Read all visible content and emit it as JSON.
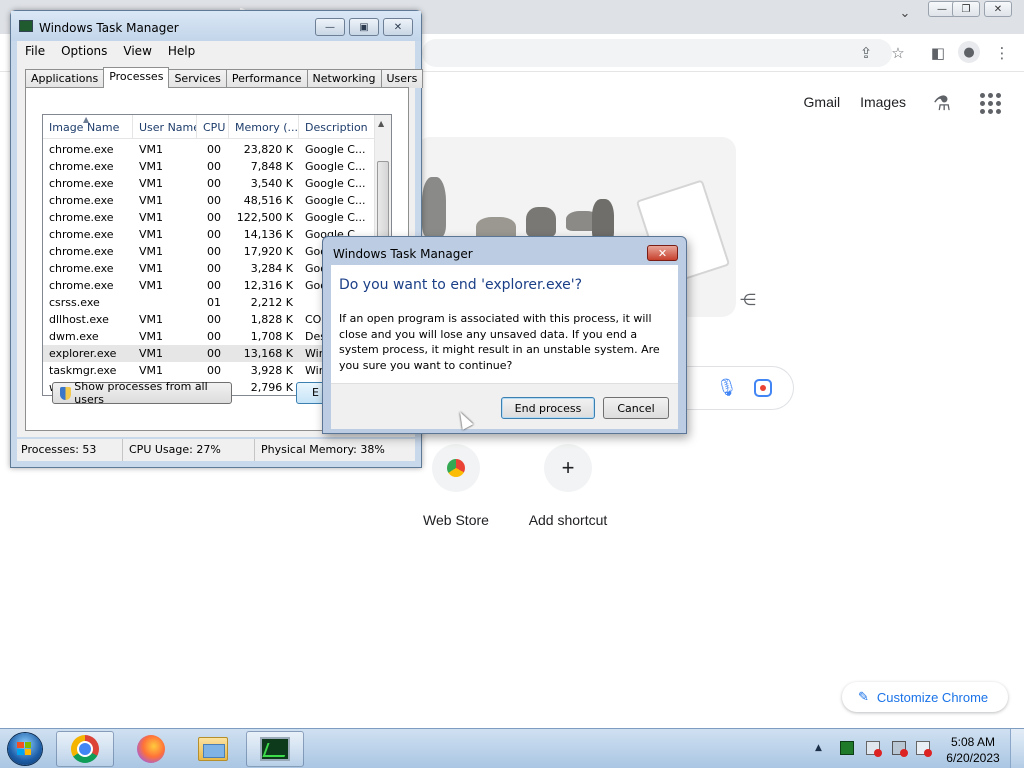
{
  "chrome": {
    "header_links": [
      "Gmail",
      "Images"
    ],
    "shortcuts": [
      {
        "label": "Web Store"
      },
      {
        "label": "Add shortcut",
        "glyph": "+"
      }
    ],
    "customize_label": "Customize Chrome"
  },
  "taskmgr": {
    "title": "Windows Task Manager",
    "menu": [
      "File",
      "Options",
      "View",
      "Help"
    ],
    "tabs": [
      "Applications",
      "Processes",
      "Services",
      "Performance",
      "Networking",
      "Users"
    ],
    "active_tab": "Processes",
    "columns": [
      "Image Name",
      "User Name",
      "CPU",
      "Memory (...",
      "Description"
    ],
    "rows": [
      {
        "image": "chrome.exe",
        "user": "VM1",
        "cpu": "00",
        "mem": "23,820 K",
        "desc": "Google C..."
      },
      {
        "image": "chrome.exe",
        "user": "VM1",
        "cpu": "00",
        "mem": "7,848 K",
        "desc": "Google C..."
      },
      {
        "image": "chrome.exe",
        "user": "VM1",
        "cpu": "00",
        "mem": "3,540 K",
        "desc": "Google C..."
      },
      {
        "image": "chrome.exe",
        "user": "VM1",
        "cpu": "00",
        "mem": "48,516 K",
        "desc": "Google C..."
      },
      {
        "image": "chrome.exe",
        "user": "VM1",
        "cpu": "00",
        "mem": "122,500 K",
        "desc": "Google C..."
      },
      {
        "image": "chrome.exe",
        "user": "VM1",
        "cpu": "00",
        "mem": "14,136 K",
        "desc": "Google C..."
      },
      {
        "image": "chrome.exe",
        "user": "VM1",
        "cpu": "00",
        "mem": "17,920 K",
        "desc": "Goo"
      },
      {
        "image": "chrome.exe",
        "user": "VM1",
        "cpu": "00",
        "mem": "3,284 K",
        "desc": "Goo"
      },
      {
        "image": "chrome.exe",
        "user": "VM1",
        "cpu": "00",
        "mem": "12,316 K",
        "desc": "Goo"
      },
      {
        "image": "csrss.exe",
        "user": "",
        "cpu": "01",
        "mem": "2,212 K",
        "desc": ""
      },
      {
        "image": "dllhost.exe",
        "user": "VM1",
        "cpu": "00",
        "mem": "1,828 K",
        "desc": "CO"
      },
      {
        "image": "dwm.exe",
        "user": "VM1",
        "cpu": "00",
        "mem": "1,708 K",
        "desc": "Des"
      },
      {
        "image": "explorer.exe",
        "user": "VM1",
        "cpu": "00",
        "mem": "13,168 K",
        "desc": "Win",
        "selected": true
      },
      {
        "image": "taskmgr.exe",
        "user": "VM1",
        "cpu": "00",
        "mem": "3,928 K",
        "desc": "Win"
      },
      {
        "image": "winlogon.exe",
        "user": "",
        "cpu": "00",
        "mem": "2,796 K",
        "desc": ""
      }
    ],
    "show_all_label": "Show processes from all users",
    "end_label_partial": "E",
    "status": {
      "processes": "Processes: 53",
      "cpu": "CPU Usage: 27%",
      "memory": "Physical Memory: 38%"
    }
  },
  "dialog": {
    "title": "Windows Task Manager",
    "heading": "Do you want to end 'explorer.exe'?",
    "message": "If an open program is associated with this process, it will close and you will lose any unsaved data. If you end a system process, it might result in an unstable system. Are you sure you want to continue?",
    "confirm_label": "End process",
    "cancel_label": "Cancel"
  },
  "taskbar": {
    "apps": [
      {
        "name": "chrome",
        "icon": "chrome-icon",
        "active": true
      },
      {
        "name": "firefox",
        "icon": "firefox-icon",
        "active": false
      },
      {
        "name": "explorer",
        "icon": "folder-icon",
        "active": false
      },
      {
        "name": "taskmgr",
        "icon": "task-manager-icon",
        "active": true
      }
    ],
    "time": "5:08 AM",
    "date": "6/20/2023"
  },
  "colors": {
    "chrome_accent": "#1a73e8",
    "dialog_heading": "#1b3f87",
    "close_button": "#c7402d"
  }
}
